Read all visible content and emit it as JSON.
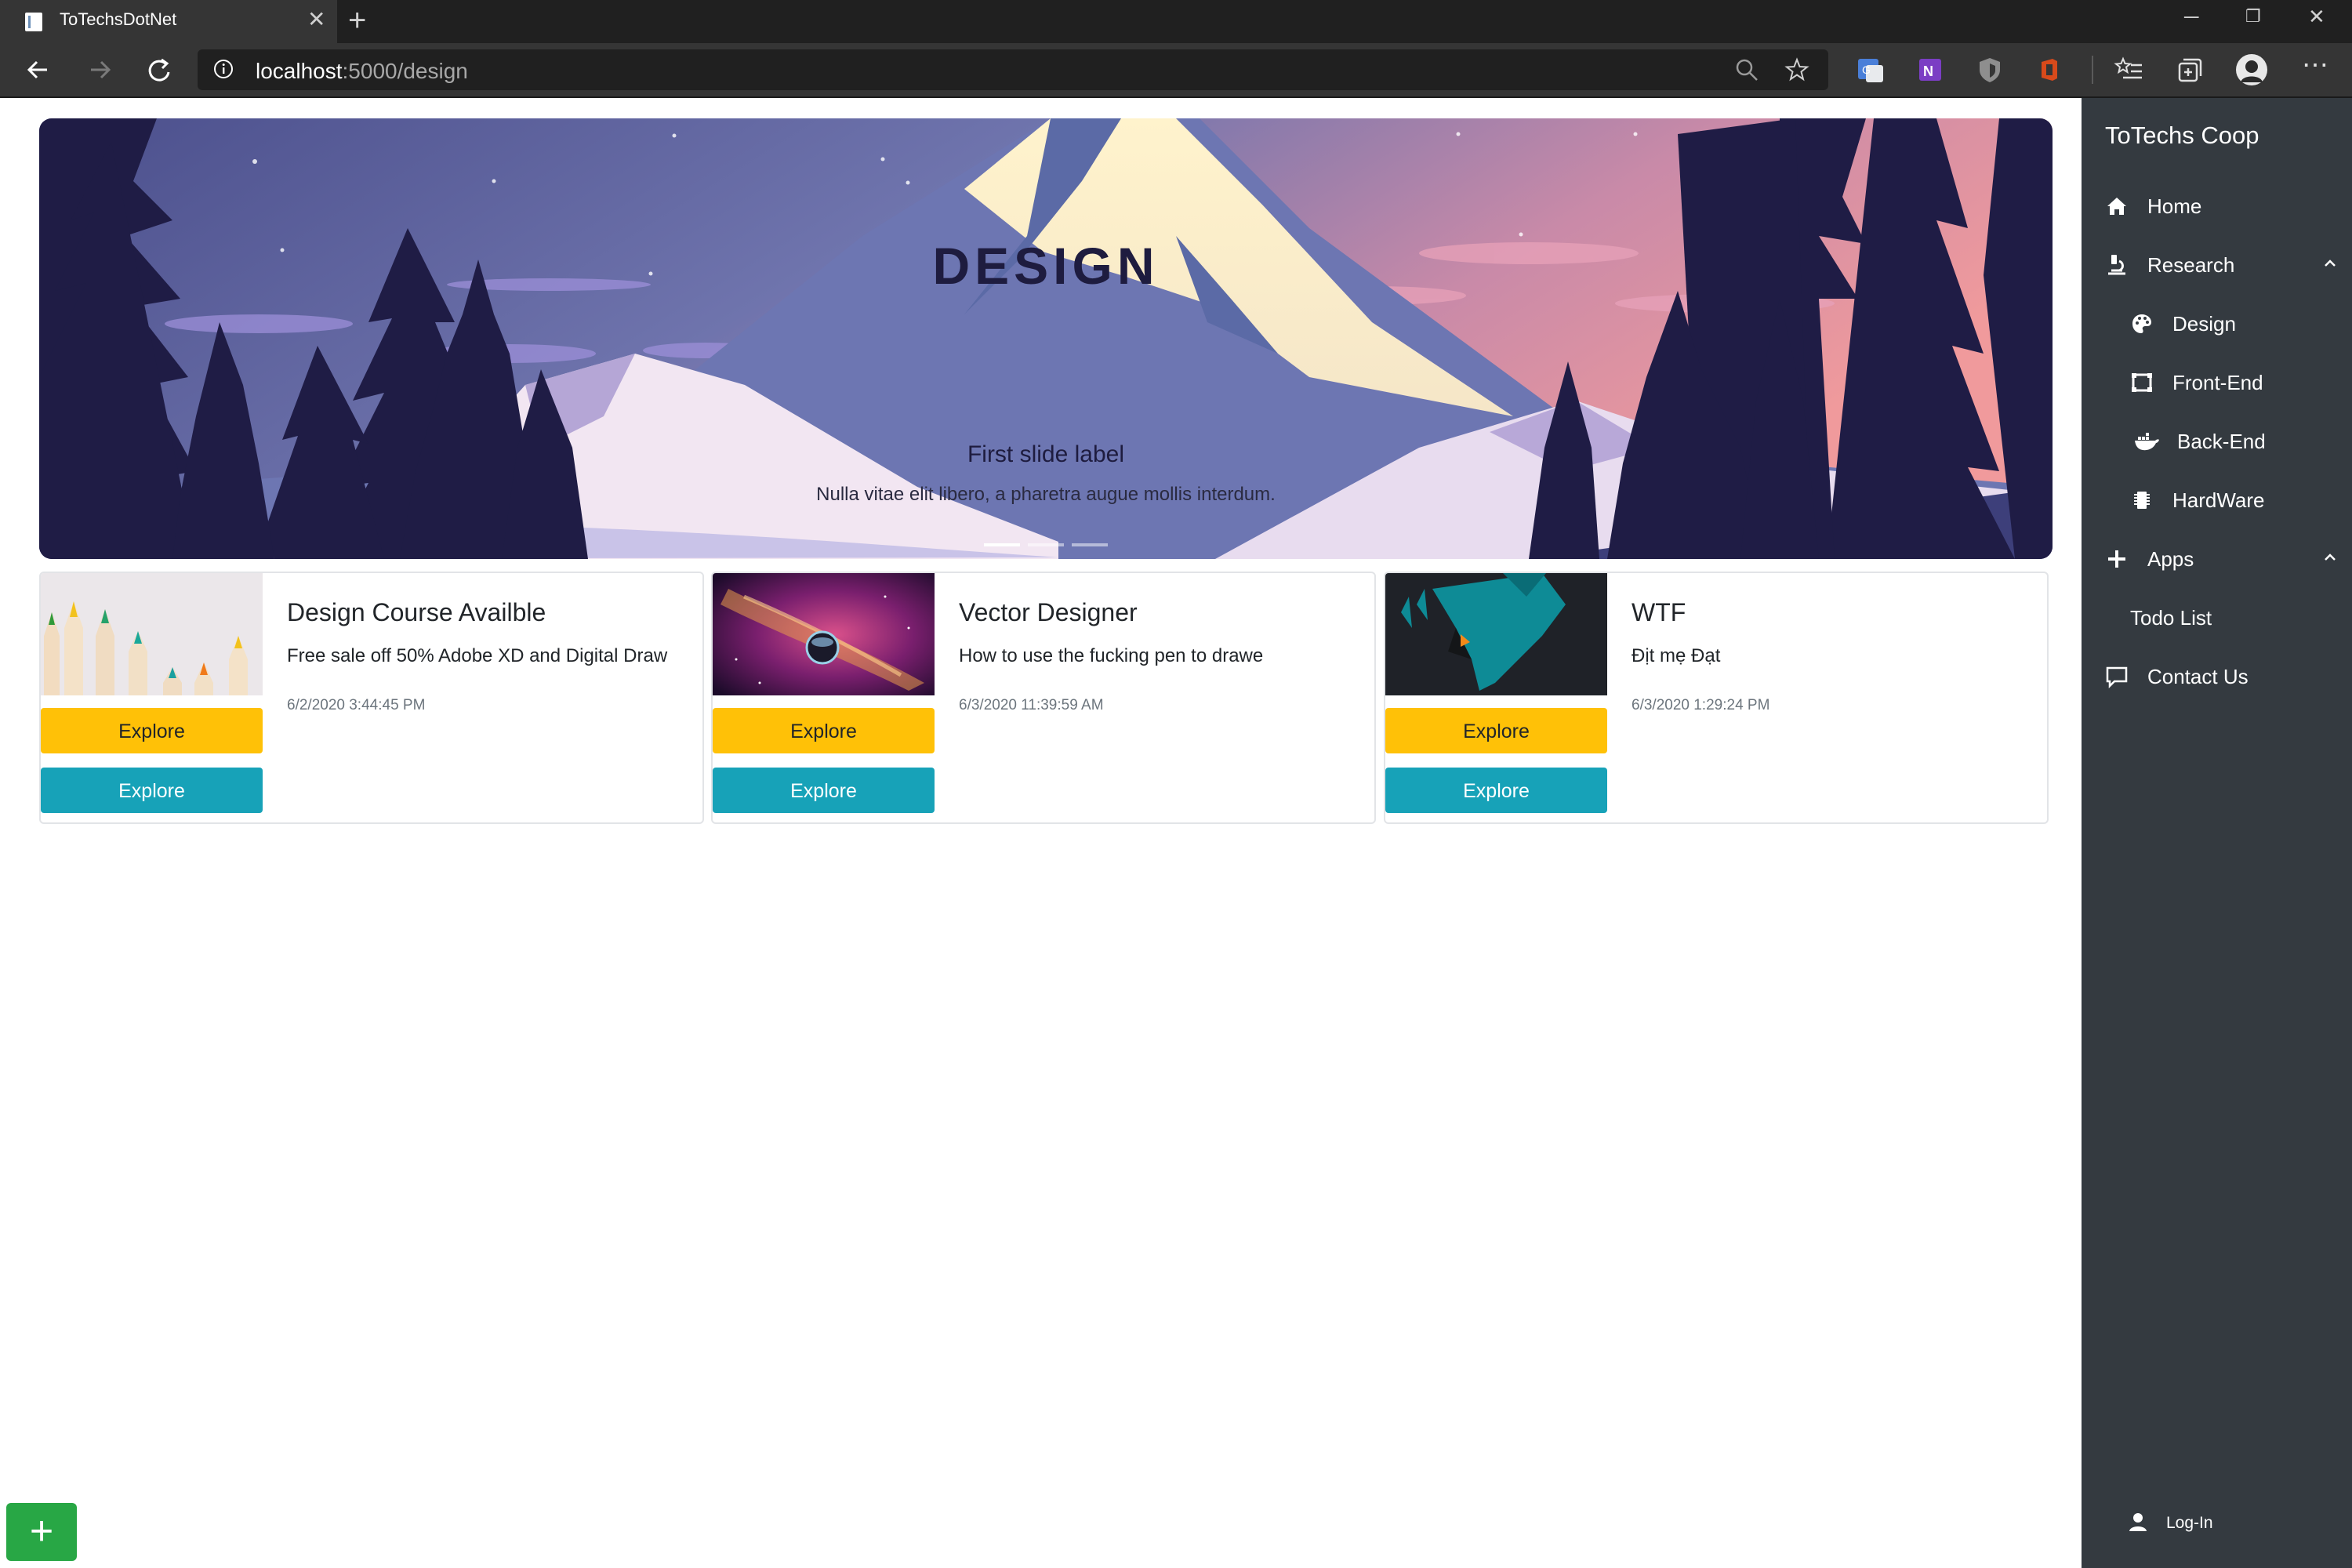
{
  "browser": {
    "tab_title": "ToTechsDotNet",
    "url_host": "localhost",
    "url_rest": ":5000/design"
  },
  "hero": {
    "title": "DESIGN",
    "caption_title": "First slide label",
    "caption_text": "Nulla vitae elit libero, a pharetra augue mollis interdum."
  },
  "cards": [
    {
      "title": "Design Course Availble",
      "text": "Free sale off 50% Adobe XD and Digital Draw",
      "date": "6/2/2020 3:44:45 PM",
      "button_primary": "Explore",
      "button_secondary": "Explore"
    },
    {
      "title": "Vector Designer",
      "text": "How to use the fucking pen to drawe",
      "date": "6/3/2020 11:39:59 AM",
      "button_primary": "Explore",
      "button_secondary": "Explore"
    },
    {
      "title": "WTF",
      "text": "Địt mẹ Đạt",
      "date": "6/3/2020 1:29:24 PM",
      "button_primary": "Explore",
      "button_secondary": "Explore"
    }
  ],
  "sidebar": {
    "brand": "ToTechs Coop",
    "items": [
      {
        "label": "Home",
        "icon": "home-icon"
      },
      {
        "label": "Research",
        "icon": "research-icon"
      },
      {
        "label": "Design",
        "icon": "palette-icon"
      },
      {
        "label": "Front-End",
        "icon": "frontend-icon"
      },
      {
        "label": "Back-End",
        "icon": "docker-icon"
      },
      {
        "label": "HardWare",
        "icon": "chip-icon"
      },
      {
        "label": "Apps",
        "icon": "plus-icon"
      },
      {
        "label": "Todo List",
        "icon": ""
      },
      {
        "label": "Contact Us",
        "icon": "comment-icon"
      }
    ],
    "login": "Log-In"
  },
  "fab": {
    "label": "+"
  },
  "colors": {
    "sidebar_bg": "#343a40",
    "warning": "#ffc107",
    "info": "#17a2b8",
    "success": "#28a745"
  }
}
